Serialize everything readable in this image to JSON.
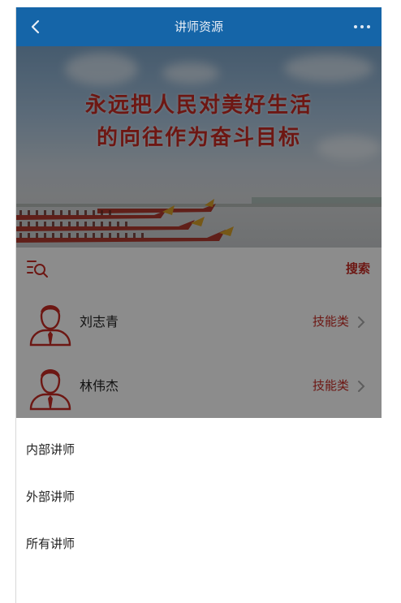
{
  "header": {
    "title": "讲师资源",
    "back_icon": "chevron-left-icon",
    "more_icon": "more-horizontal-icon",
    "color": "#1565a8"
  },
  "banner": {
    "line1": "永远把人民对美好生活",
    "line2": "的向往作为奋斗目标",
    "text_color": "#c62b24"
  },
  "search": {
    "filter_icon": "filter-search-icon",
    "label": "搜索"
  },
  "instructors": [
    {
      "name": "刘志青",
      "category": "技能类"
    },
    {
      "name": "林伟杰",
      "category": "技能类"
    }
  ],
  "sheet": {
    "options": [
      "内部讲师",
      "外部讲师",
      "所有讲师"
    ]
  },
  "accent_color": "#c62b24"
}
